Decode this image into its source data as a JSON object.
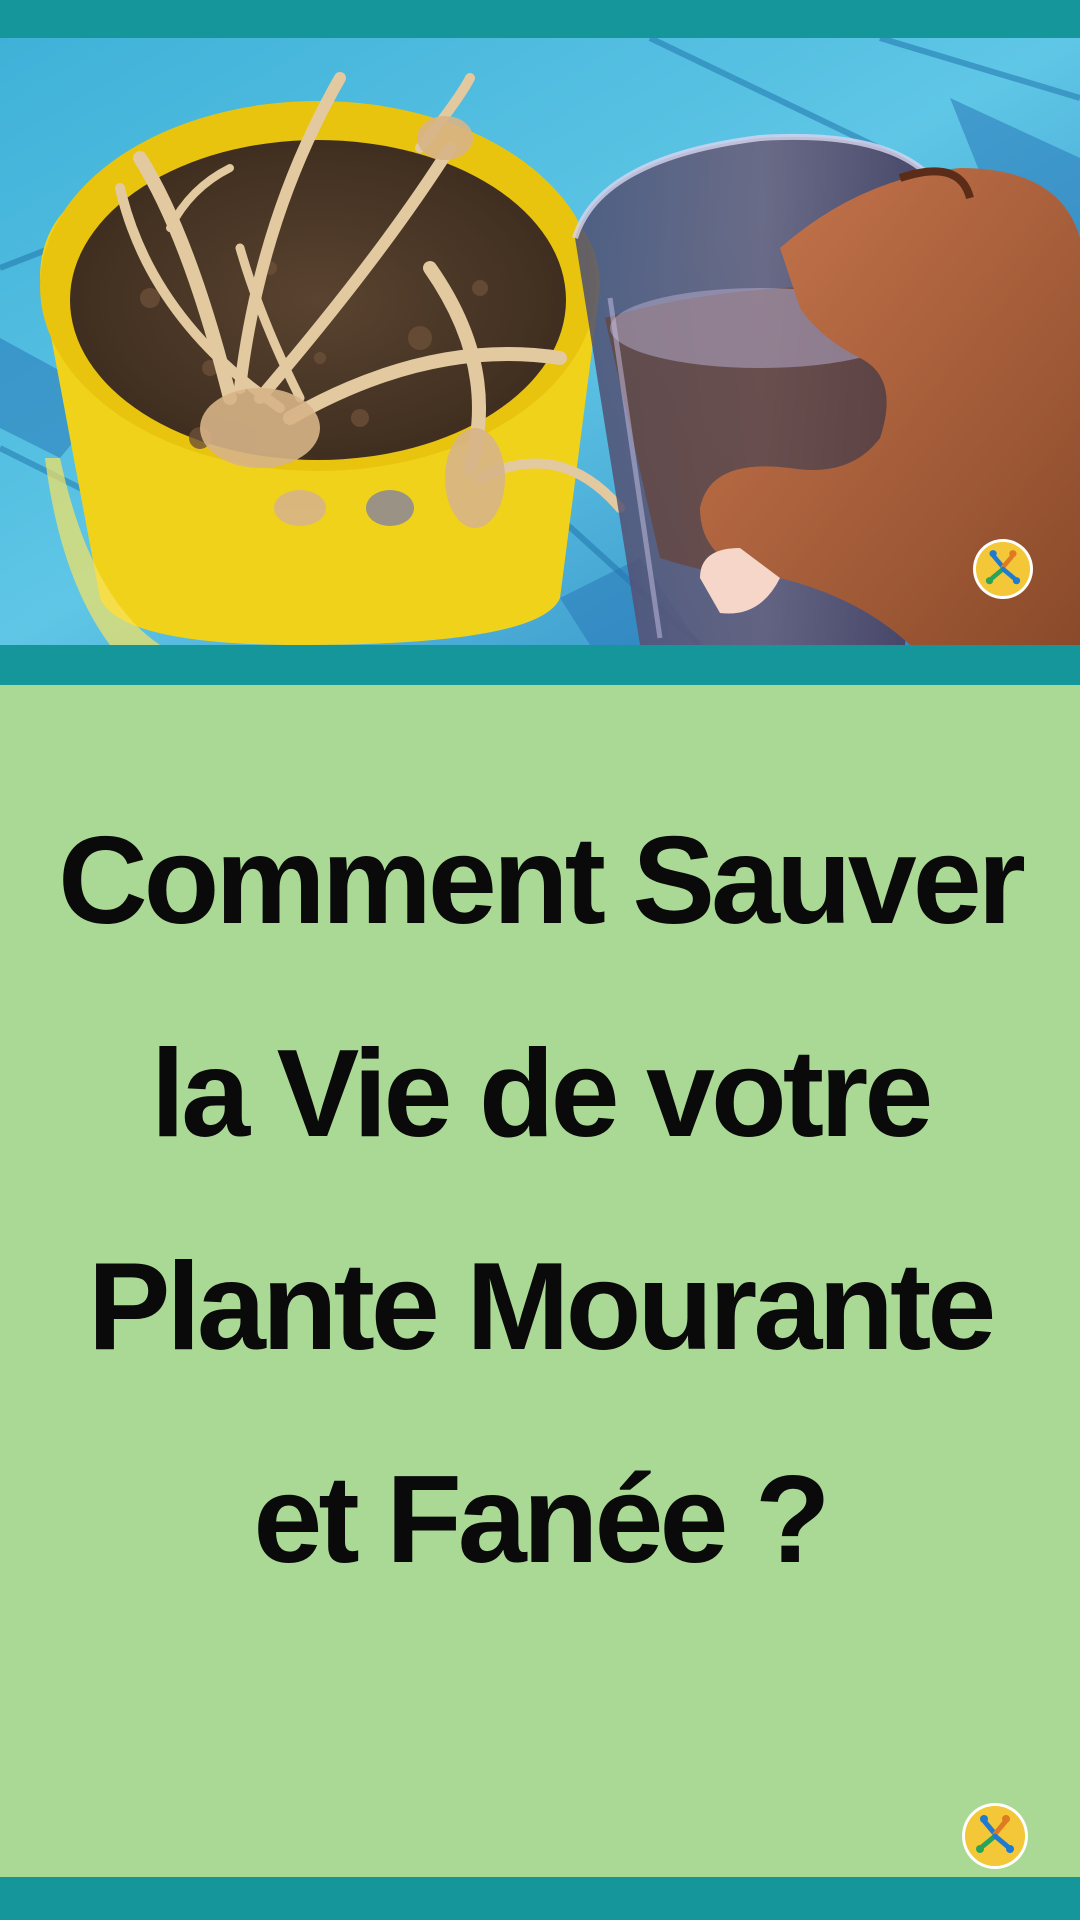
{
  "page": {
    "headline": "Comment Sauver la Vie de votre Plante Mourante et Fanée ?",
    "colors": {
      "band": "#14969a",
      "panel": "#a9d994",
      "text": "#0a0a0a",
      "pot": "#f0d21a",
      "logo": "#f3c737"
    }
  },
  "photo": {
    "subject_icons": [
      "withered-plant-icon",
      "yellow-pot-icon",
      "glass-of-liquid-icon",
      "hand-icon"
    ]
  },
  "logos": {
    "icon": "brand-logo-icon"
  }
}
